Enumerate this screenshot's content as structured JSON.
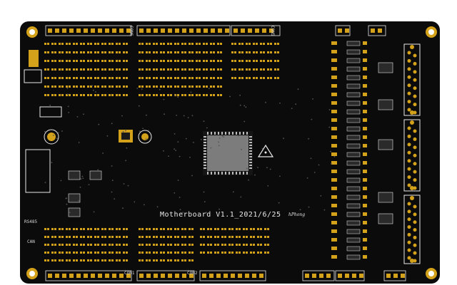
{
  "board": {
    "title": "Motherboard V1.1_2021/6/25",
    "author": "hPhong",
    "colors": {
      "solder_mask": "#0b0b0b",
      "pad_gold": "#d4a21a",
      "silkscreen": "#e8e8e8",
      "chip_body": "#2a2a2a",
      "mcu_pad": "#8a8a8a",
      "background": "#ffffff"
    }
  },
  "connector_labels": {
    "top": [
      "CON6",
      "CON5"
    ],
    "bottom": [
      "CON2",
      "CON1"
    ],
    "left": [
      "RS485",
      "CAN"
    ]
  },
  "icons": [
    "esd-warning-icon",
    "mounting-hole-icon"
  ]
}
